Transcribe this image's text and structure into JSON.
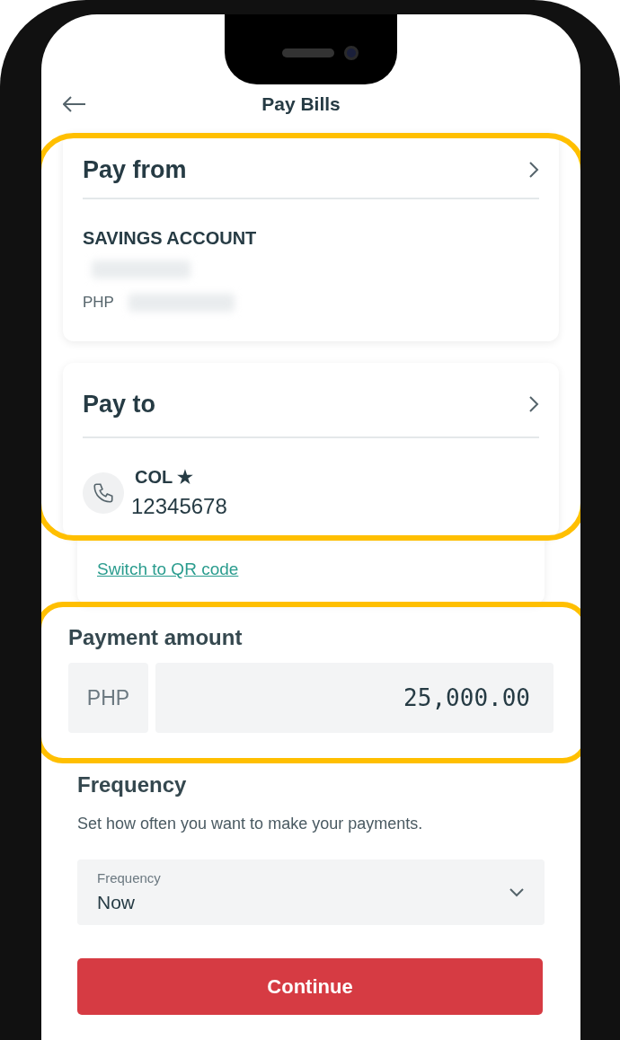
{
  "header": {
    "title": "Pay Bills"
  },
  "pay_from": {
    "title": "Pay from",
    "account_type": "SAVINGS ACCOUNT",
    "currency": "PHP"
  },
  "pay_to": {
    "title": "Pay to",
    "biller_name": "COL ★",
    "number": "12345678"
  },
  "switch_link": "Switch to QR code",
  "payment_amount": {
    "title": "Payment amount",
    "currency": "PHP",
    "value": "25,000.00"
  },
  "frequency": {
    "title": "Frequency",
    "description": "Set how often you want to make your payments.",
    "field_label": "Frequency",
    "value": "Now"
  },
  "continue_button": "Continue"
}
